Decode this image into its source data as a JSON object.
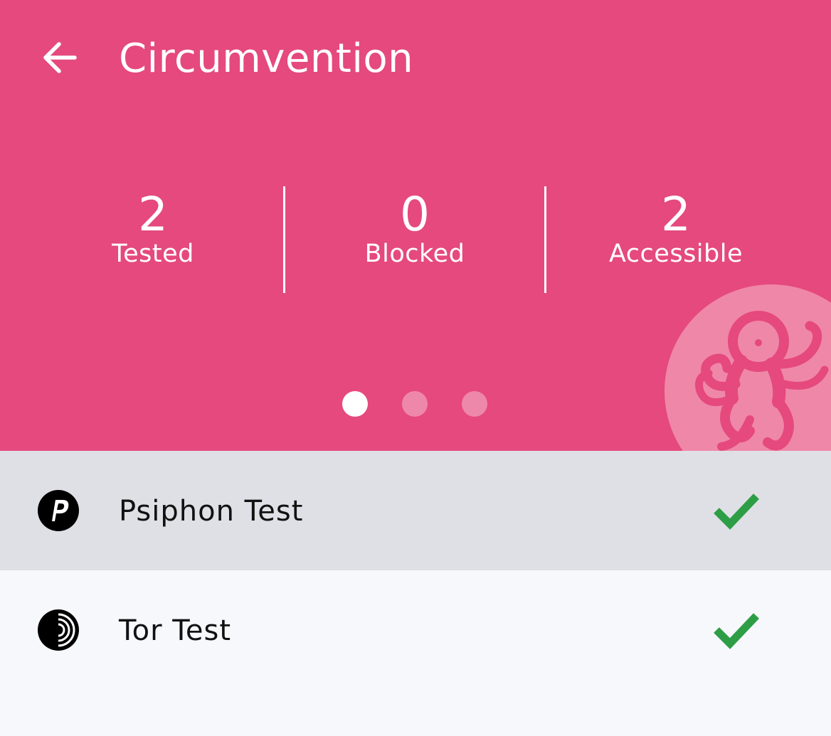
{
  "header": {
    "title": "Circumvention",
    "back_icon": "arrow-back-icon",
    "background_color": "#e5497e"
  },
  "stats": {
    "tested": {
      "value": "2",
      "label": "Tested"
    },
    "blocked": {
      "value": "0",
      "label": "Blocked"
    },
    "accessible": {
      "value": "2",
      "label": "Accessible"
    }
  },
  "pager": {
    "pages": 3,
    "active_index": 0
  },
  "tests": [
    {
      "name": "Psiphon Test",
      "icon": "psiphon-icon",
      "status": "ok",
      "status_icon": "checkmark-icon",
      "status_color": "#2e9e46",
      "selected": true
    },
    {
      "name": "Tor Test",
      "icon": "tor-icon",
      "status": "ok",
      "status_icon": "checkmark-icon",
      "status_color": "#2e9e46",
      "selected": false
    }
  ]
}
